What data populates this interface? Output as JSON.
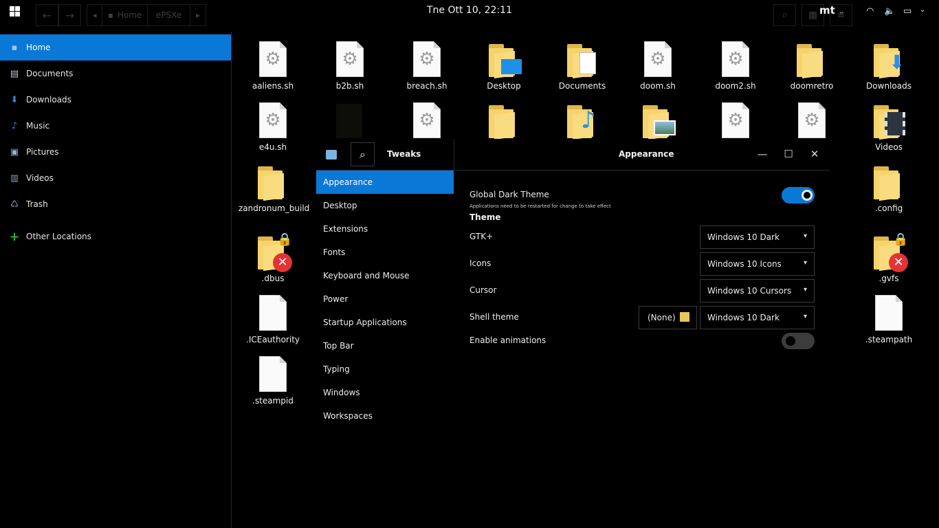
{
  "topbar": {
    "clock": "Tne Ott 10, 22:11",
    "breadcrumb": [
      "Home",
      "ePSXe"
    ],
    "user": "mt",
    "icons": [
      "windows-logo",
      "back-arrow",
      "forward-arrow",
      "search-icon",
      "grid-icon",
      "menu-icon",
      "wifi-icon",
      "volume-icon",
      "battery-icon"
    ]
  },
  "sidebar": {
    "items": [
      {
        "label": "Home",
        "icon": "home-icon"
      },
      {
        "label": "Documents",
        "icon": "documents-icon"
      },
      {
        "label": "Downloads",
        "icon": "downloads-icon"
      },
      {
        "label": "Music",
        "icon": "music-icon"
      },
      {
        "label": "Pictures",
        "icon": "pictures-icon"
      },
      {
        "label": "Videos",
        "icon": "videos-icon"
      },
      {
        "label": "Trash",
        "icon": "trash-icon"
      },
      {
        "label": "Other Locations",
        "icon": "plus-icon"
      }
    ]
  },
  "files": {
    "aaliens": "aaliens.sh",
    "b2b": "b2b.sh",
    "breach": "breach.sh",
    "desktop": "Desktop",
    "documents": "Documents",
    "doom": "doom.sh",
    "doom2": "doom2.sh",
    "doomretro": "doomretro",
    "downloads": "Downloads",
    "e4u": "e4u.sh",
    "videos": "Videos",
    "zandronum": "zandronum_build",
    "config": ".config",
    "dbus": ".dbus",
    "gvfs": ".gvfs",
    "iceauthority": ".ICEauthority",
    "steampath": ".steampath",
    "steampid": ".steampid"
  },
  "tweaks": {
    "app_title": "Tweaks",
    "panel_title": "Appearance",
    "nav": [
      "Appearance",
      "Desktop",
      "Extensions",
      "Fonts",
      "Keyboard and Mouse",
      "Power",
      "Startup Applications",
      "Top Bar",
      "Typing",
      "Windows",
      "Workspaces"
    ],
    "global_dark_label": "Global Dark Theme",
    "global_dark_hint": "Applications need to be restarted for change to take effect",
    "global_dark_on": true,
    "theme_section": "Theme",
    "gtk_label": "GTK+",
    "gtk_value": "Windows 10 Dark",
    "icons_label": "Icons",
    "icons_value": "Windows 10 Icons",
    "cursor_label": "Cursor",
    "cursor_value": "Windows 10 Cursors",
    "shell_label": "Shell theme",
    "shell_file": "(None)",
    "shell_value": "Windows 10 Dark",
    "animations_label": "Enable animations",
    "animations_on": false,
    "accent": "#0a78d7"
  }
}
